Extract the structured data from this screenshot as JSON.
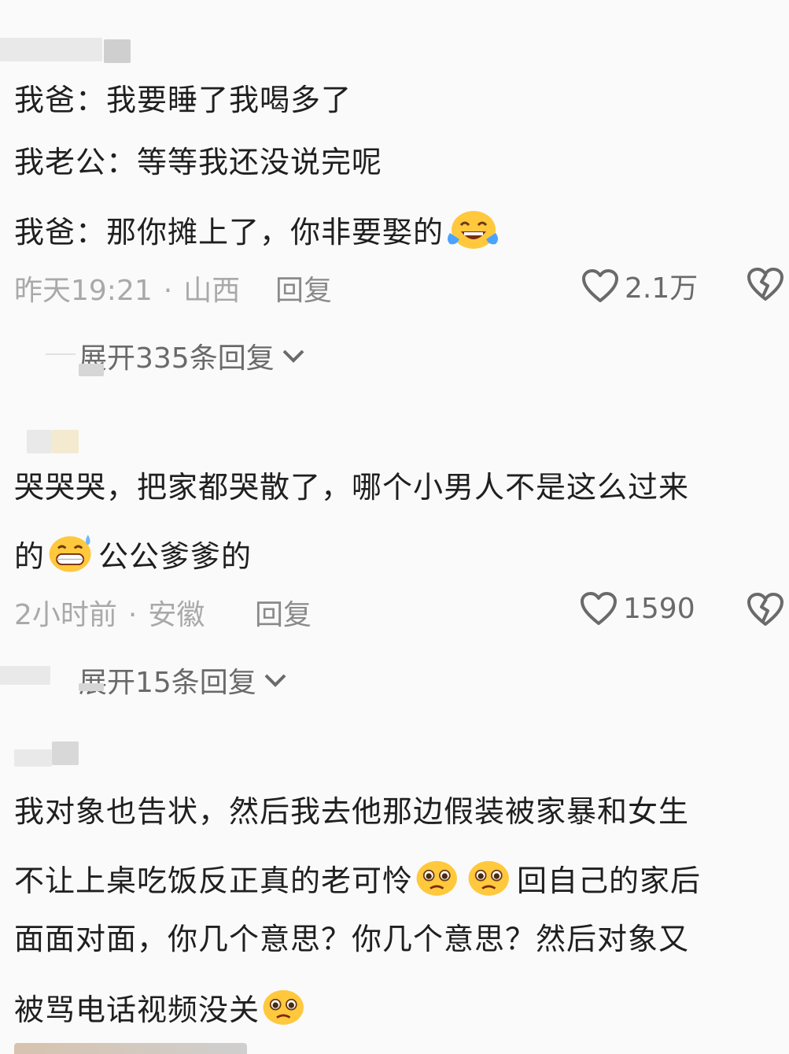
{
  "comments": [
    {
      "lines": [
        "我爸：我要睡了我喝多了",
        "我老公：等等我还没说完呢",
        "我爸：那你摊上了，你非要娶的"
      ],
      "line_emoji": [
        "",
        "",
        "tears-of-joy-emoji"
      ],
      "time": "昨天19:21",
      "location": "山西",
      "reply_label": "回复",
      "likes": "2.1万",
      "expand_label": "展开335条回复"
    },
    {
      "lines": [
        "哭哭哭，把家都哭散了，哪个小男人不是这么过来",
        "的",
        "公公爹爹的"
      ],
      "time": "2小时前",
      "location": "安徽",
      "reply_label": "回复",
      "likes": "1590",
      "expand_label": "展开15条回复"
    },
    {
      "lines": [
        "我对象也告状，然后我去他那边假装被家暴和女生",
        "不让上桌吃饭反正真的老可怜",
        "回自己的家后",
        "面面对面，你几个意思？你几个意思？然后对象又",
        "被骂电话视频没关"
      ]
    }
  ],
  "icons": {
    "like": "heart-outline-icon",
    "dislike": "broken-heart-icon",
    "expand": "chevron-down-icon"
  },
  "colors": {
    "text": "#1f1f1f",
    "meta": "#a9a9a9",
    "background": "#fafafa",
    "emoji_yellow": "#ffc83d"
  }
}
